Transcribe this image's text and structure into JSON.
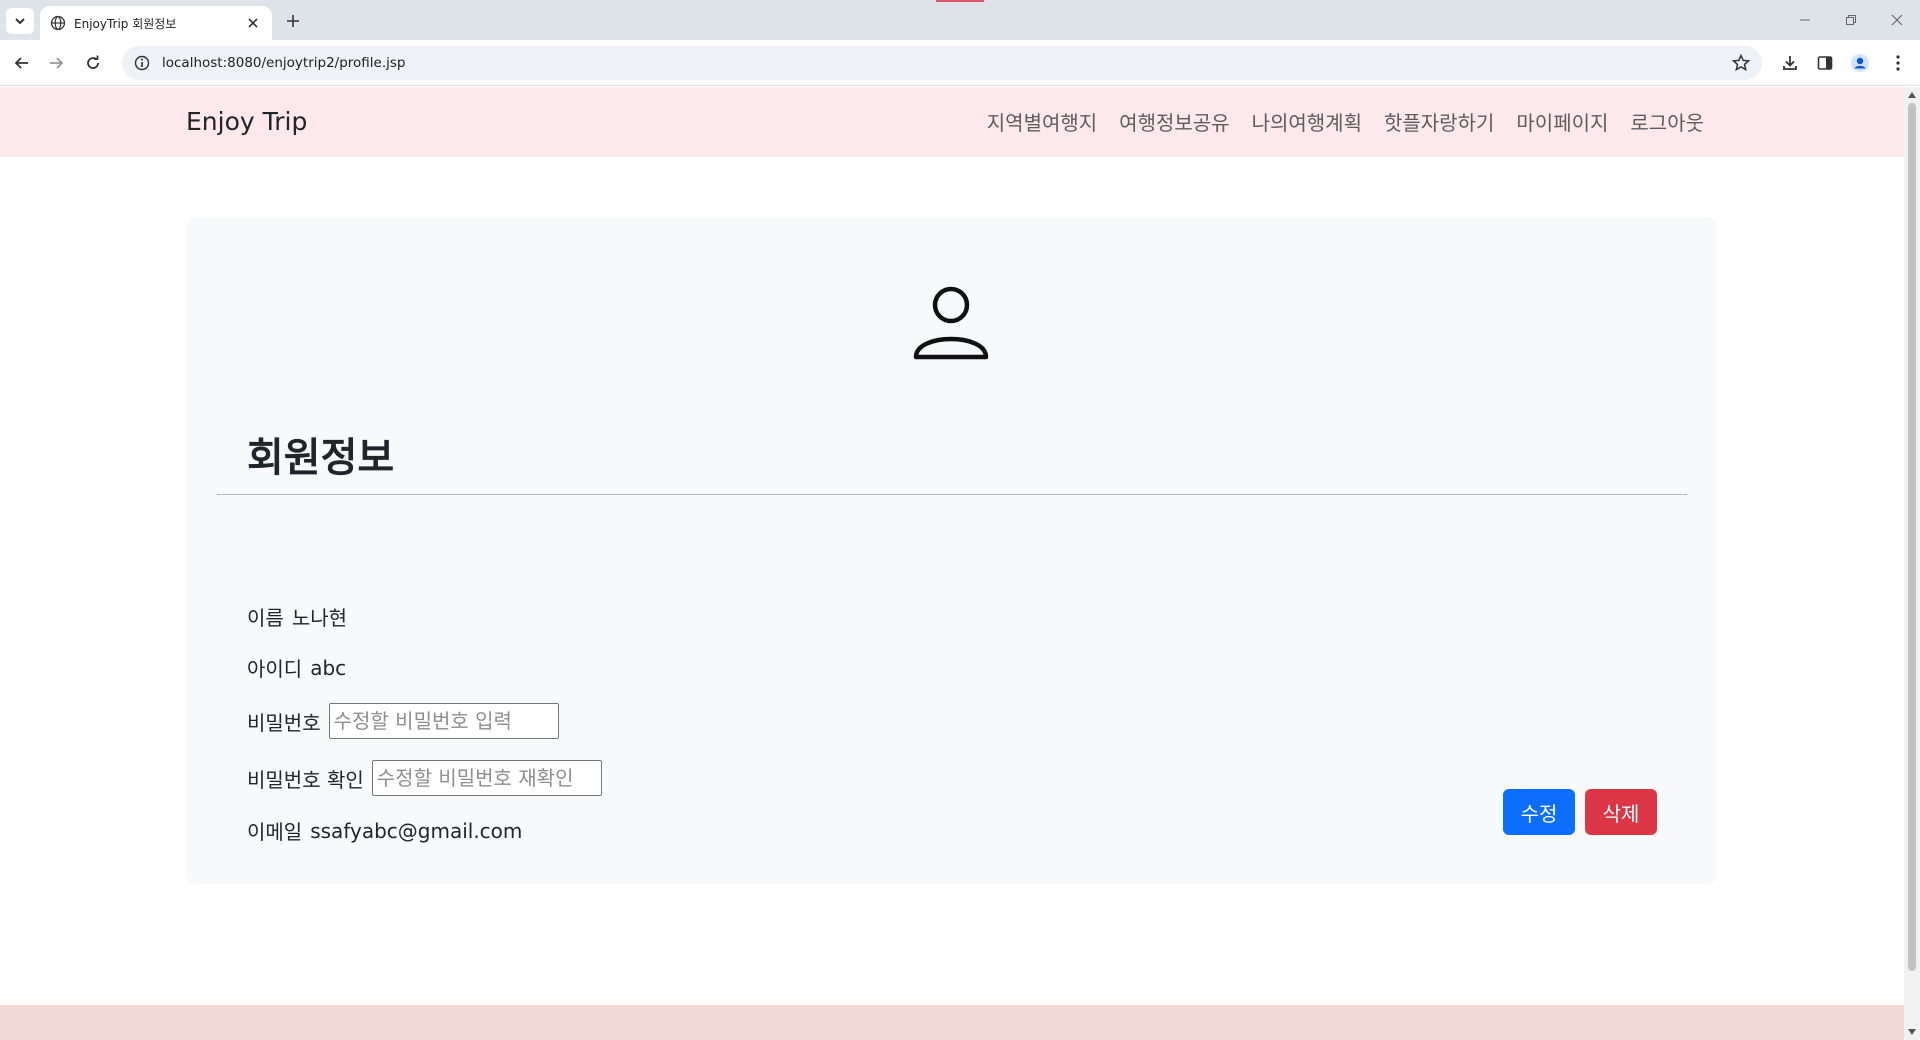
{
  "browser": {
    "tab_title": "EnjoyTrip 회원정보",
    "url": "localhost:8080/enjoytrip2/profile.jsp"
  },
  "site": {
    "brand": "Enjoy Trip",
    "nav": [
      {
        "label": "지역별여행지"
      },
      {
        "label": "여행정보공유"
      },
      {
        "label": "나의여행계획"
      },
      {
        "label": "핫플자랑하기"
      },
      {
        "label": "마이페이지"
      },
      {
        "label": "로그아웃"
      }
    ]
  },
  "profile": {
    "title": "회원정보",
    "name_label": "이름",
    "name_value": "노나현",
    "id_label": "아이디",
    "id_value": "abc",
    "password_label": "비밀번호",
    "password_placeholder": "수정할 비밀번호 입력",
    "password_confirm_label": "비밀번호 확인",
    "password_confirm_placeholder": "수정할 비밀번호 재확인",
    "email_label": "이메일",
    "email_value": "ssafyabc@gmail.com",
    "edit_button": "수정",
    "delete_button": "삭제"
  },
  "colors": {
    "nav_bg": "#fde8ec",
    "card_bg": "#f8f9fa",
    "primary": "#0d6efd",
    "danger": "#dc3545",
    "footer_bg": "#f4d7d7"
  },
  "icons": [
    "globe-icon",
    "user-icon",
    "star-icon",
    "download-icon",
    "profile-icon"
  ]
}
